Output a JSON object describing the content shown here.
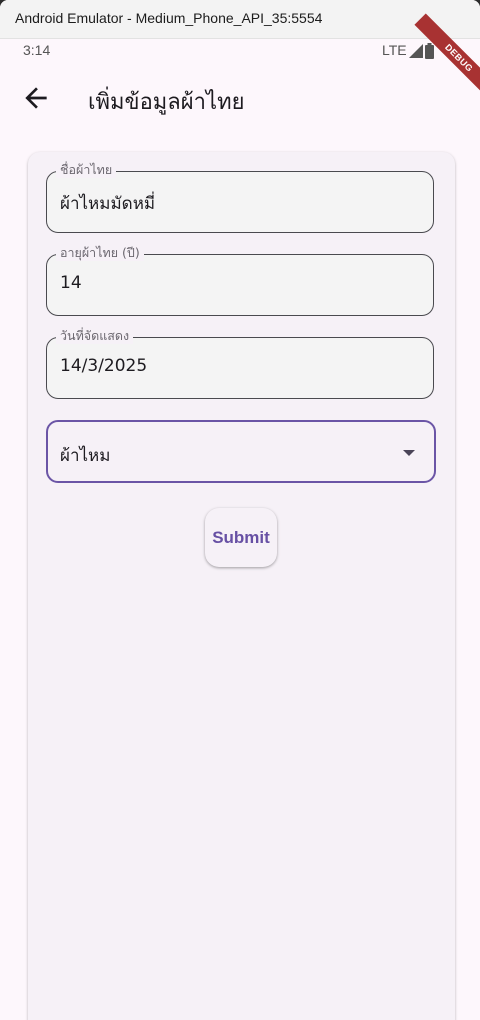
{
  "window": {
    "title": "Android Emulator - Medium_Phone_API_35:5554"
  },
  "status_bar": {
    "time": "3:14",
    "network": "LTE",
    "debug_banner": "DEBUG"
  },
  "app_bar": {
    "title": "เพิ่มข้อมูลผ้าไทย",
    "back_icon": "arrow-back-icon"
  },
  "form": {
    "name_field": {
      "label": "ชื่อผ้าไทย",
      "value": "ผ้าไหมมัดหมี่"
    },
    "age_field": {
      "label": "อายุผ้าไทย (ปี)",
      "value": "14"
    },
    "date_field": {
      "label": "วันที่จัดแสดง",
      "value": "14/3/2025"
    },
    "type_dropdown": {
      "selected": "ผ้าไหม"
    },
    "submit_label": "Submit"
  },
  "colors": {
    "accent": "#6750a4",
    "background": "#fdf7fc",
    "card": "#f6f1f7",
    "debug": "#a83232"
  }
}
